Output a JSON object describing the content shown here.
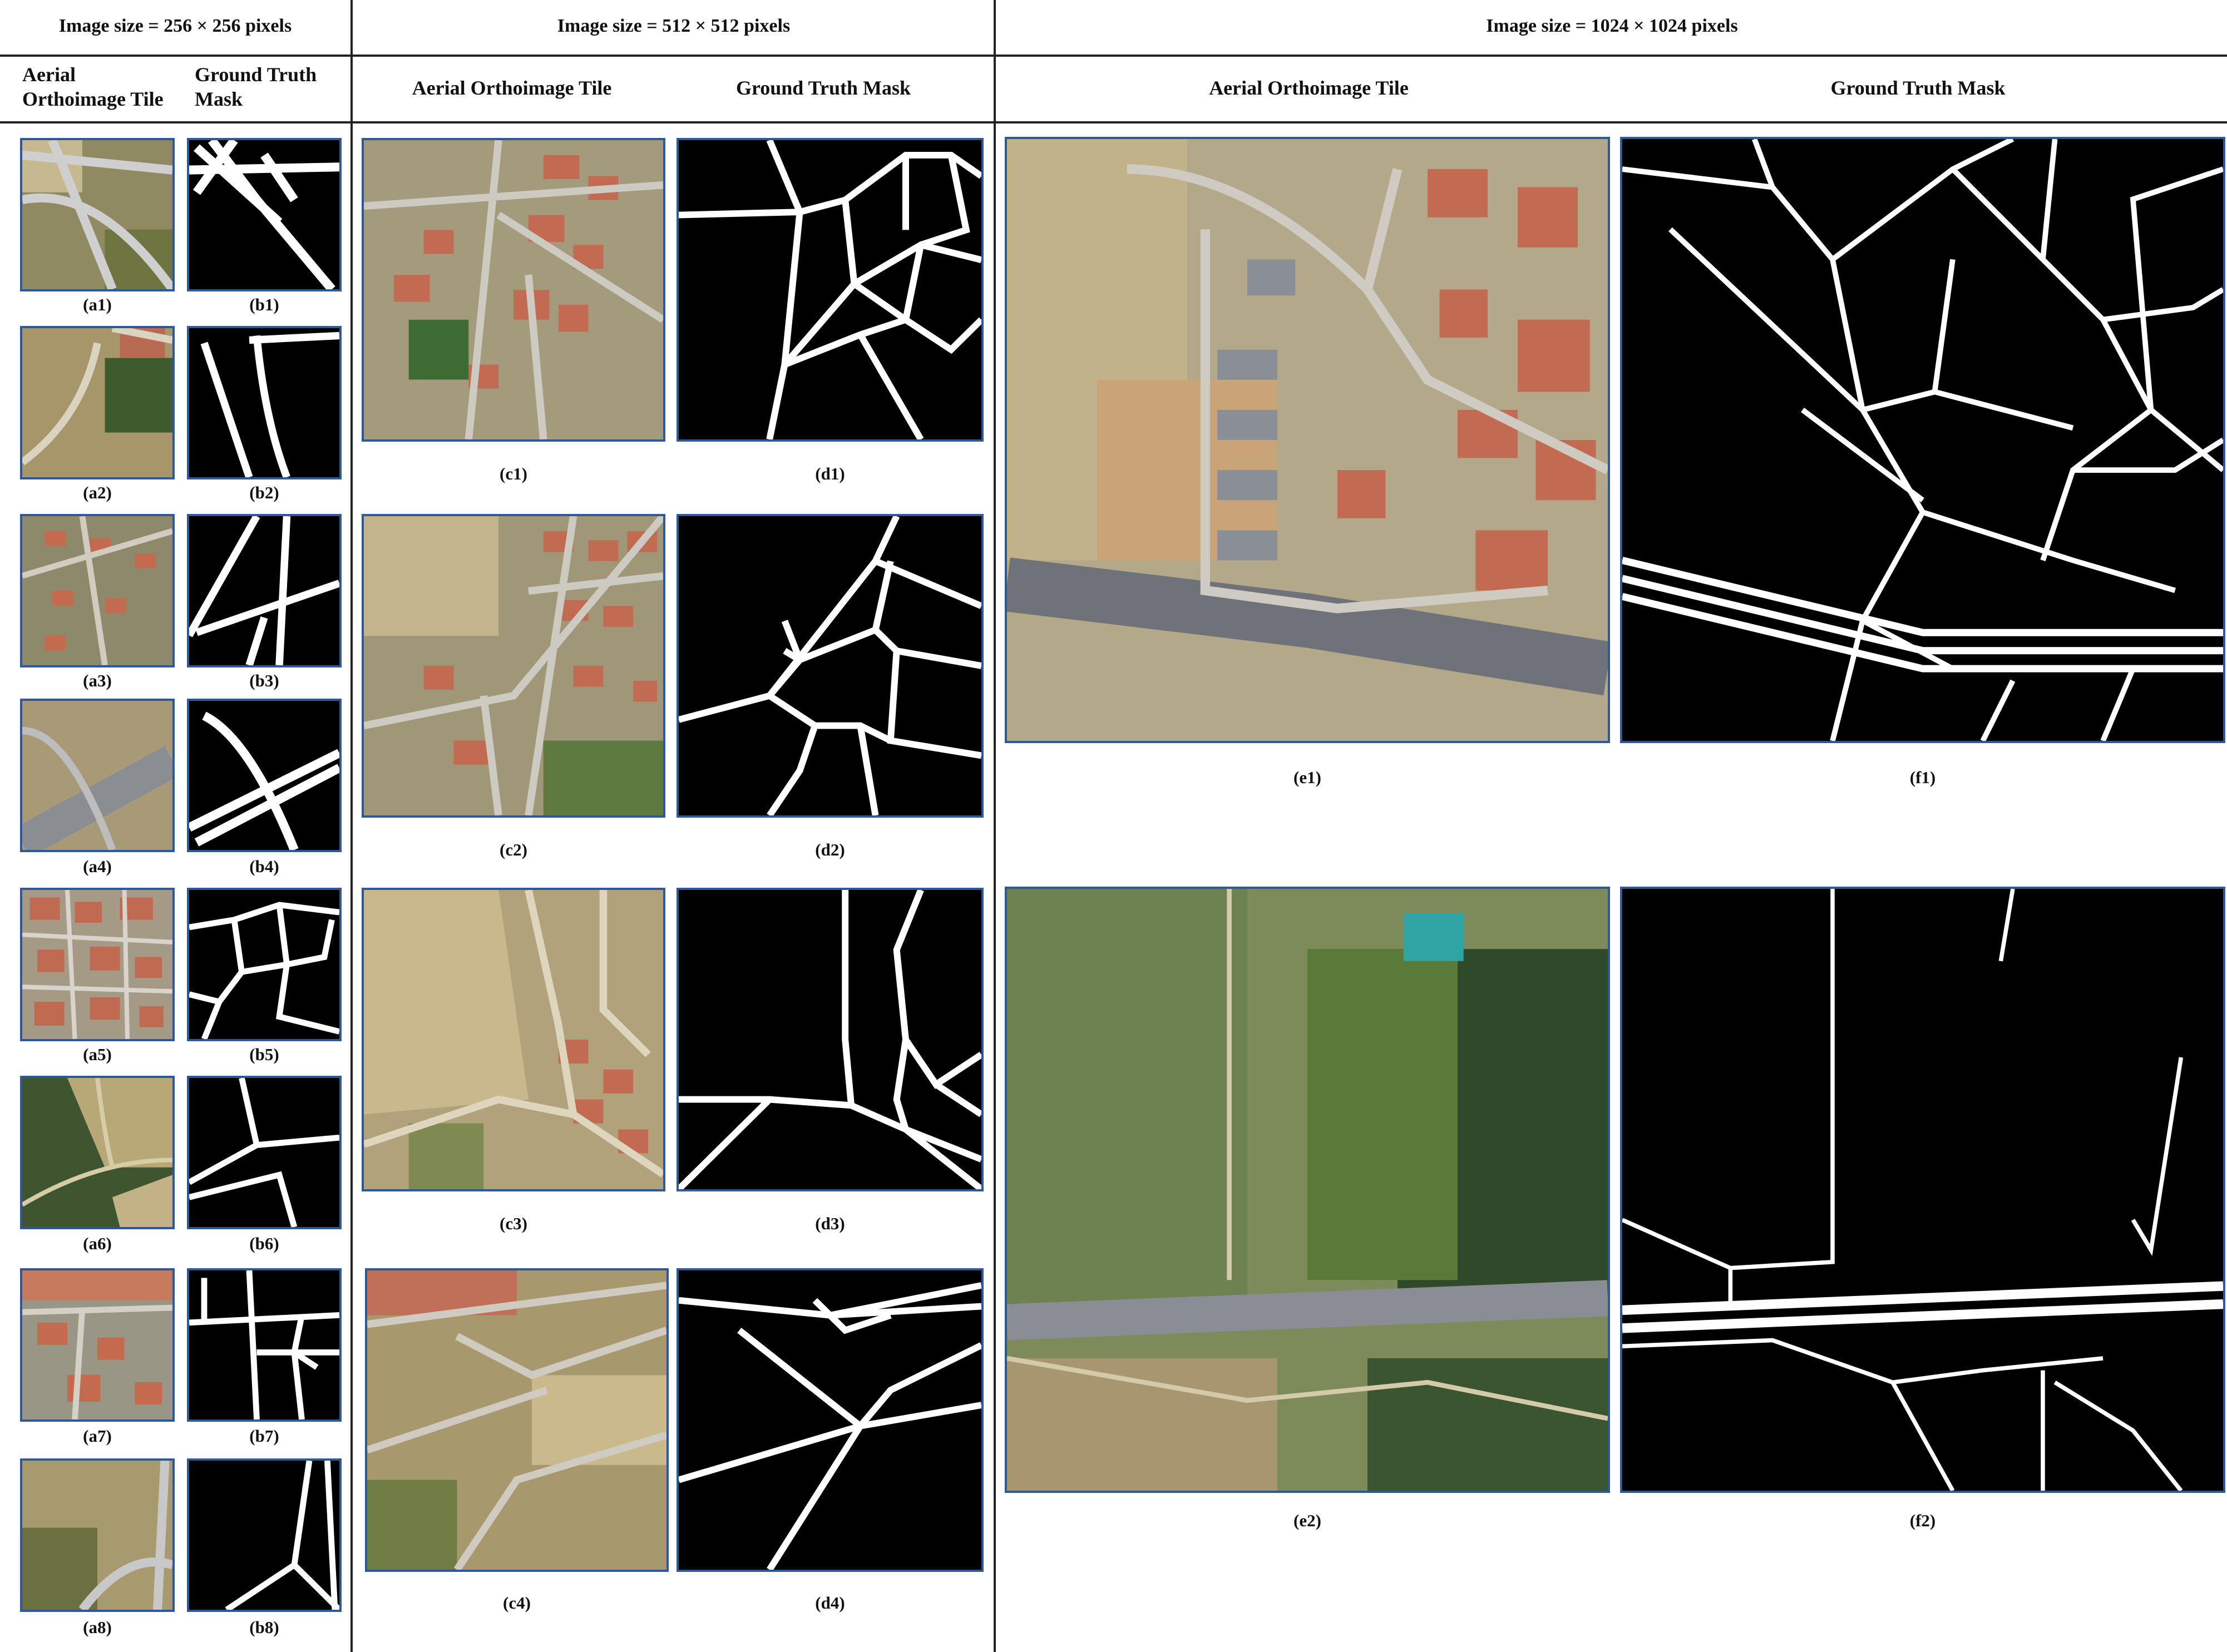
{
  "groups": [
    {
      "header": "Image size = 256 × 256 pixels",
      "col_a": "Aerial\nOrthoimage Tile",
      "col_b": "Ground Truth\nMask"
    },
    {
      "header": "Image size = 512 × 512 pixels",
      "col_a": "Aerial Orthoimage Tile",
      "col_b": "Ground Truth Mask"
    },
    {
      "header": "Image size = 1024 × 1024 pixels",
      "col_a": "Aerial  Orthoimage Tile",
      "col_b": "Ground Truth Mask"
    }
  ],
  "captions256": [
    [
      "(a1)",
      "(b1)"
    ],
    [
      "(a2)",
      "(b2)"
    ],
    [
      "(a3)",
      "(b3)"
    ],
    [
      "(a4)",
      "(b4)"
    ],
    [
      "(a5)",
      "(b5)"
    ],
    [
      "(a6)",
      "(b6)"
    ],
    [
      "(a7)",
      "(b7)"
    ],
    [
      "(a8)",
      "(b8)"
    ]
  ],
  "captions512": [
    [
      "(c1)",
      "(d1)"
    ],
    [
      "(c2)",
      "(d2)"
    ],
    [
      "(c3)",
      "(d3)"
    ],
    [
      "(c4)",
      "(d4)"
    ]
  ],
  "captions1024": [
    [
      "(e1)",
      "(f1)"
    ],
    [
      "(e2)",
      "(f2)"
    ]
  ],
  "colors": {
    "frame": "#2d5a96",
    "mask_bg": "#000000",
    "road": "#ffffff",
    "divider": "#222222"
  }
}
